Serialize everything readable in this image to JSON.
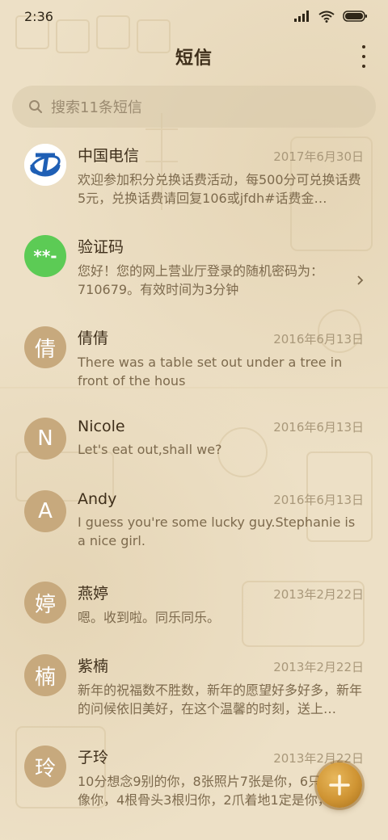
{
  "status_bar": {
    "time": "2:36"
  },
  "header": {
    "title": "短信"
  },
  "search": {
    "placeholder": "搜索11条短信"
  },
  "conversations": [
    {
      "name": "中国电信",
      "date": "2017年6月30日",
      "preview": "欢迎参加积分兑换话费活动，每500分可兑换话费5元，兑换话费请回复106或jfdh#话费金…",
      "avatar_type": "logo",
      "avatar_icon": "china-telecom-logo"
    },
    {
      "name": "验证码",
      "date": "",
      "preview": "您好！您的网上营业厅登录的随机密码为：710679。有效时间为3分钟",
      "avatar_type": "text",
      "avatar_text": "**-",
      "avatar_color": "#5ccb55"
    },
    {
      "name": "倩倩",
      "date": "2016年6月13日",
      "preview": "There was a table set out under a tree in front of the hous",
      "avatar_type": "text",
      "avatar_text": "倩",
      "avatar_color": "#c7a97d"
    },
    {
      "name": "Nicole",
      "date": "2016年6月13日",
      "preview": "Let's eat out,shall we?",
      "avatar_type": "text",
      "avatar_text": "N",
      "avatar_color": "#c7a97d"
    },
    {
      "name": "Andy",
      "date": "2016年6月13日",
      "preview": "I guess you're some lucky guy.Stephanie is a nice girl.",
      "avatar_type": "text",
      "avatar_text": "A",
      "avatar_color": "#c7a97d"
    },
    {
      "name": "燕婷",
      "date": "2013年2月22日",
      "preview": "嗯。收到啦。同乐同乐。",
      "avatar_type": "text",
      "avatar_text": "婷",
      "avatar_color": "#c7a97d"
    },
    {
      "name": "紫楠",
      "date": "2013年2月22日",
      "preview": "新年的祝福数不胜数，新年的愿望好多好多，新年的问候依旧美好，在这个温馨的时刻，送上…",
      "avatar_type": "text",
      "avatar_text": "楠",
      "avatar_color": "#c7a97d"
    },
    {
      "name": "子玲",
      "date": "2013年2月22日",
      "preview": "10分想念9别的你，8张照片7张是你，6只小狗只像你，4根骨头3根归你，2爪着地1定是你，",
      "avatar_type": "text",
      "avatar_text": "玲",
      "avatar_color": "#c7a97d"
    }
  ],
  "colors": {
    "accent": "#cf9433",
    "avatar_default": "#c7a97d",
    "verify_green": "#5ccb55"
  }
}
